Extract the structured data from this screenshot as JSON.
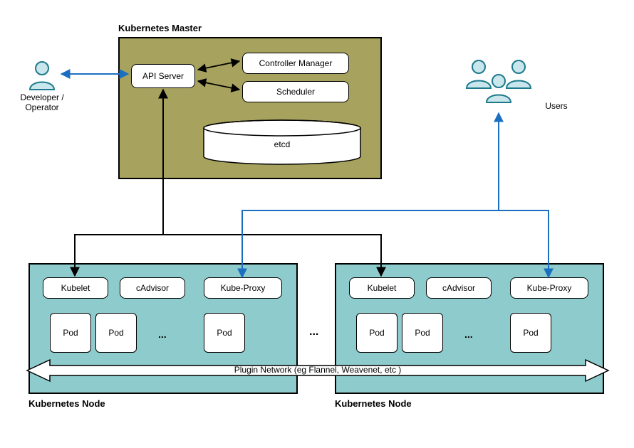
{
  "diagram": {
    "master": {
      "title": "Kubernetes Master",
      "api_server": "API Server",
      "controller_manager": "Controller Manager",
      "scheduler": "Scheduler",
      "etcd": "etcd"
    },
    "developer_label": "Developer / Operator",
    "users_label": "Users",
    "node_left": {
      "title": "Kubernetes Node",
      "kubelet": "Kubelet",
      "cadvisor": "cAdvisor",
      "kubeproxy": "Kube-Proxy",
      "pod": "Pod",
      "ellipsis": "..."
    },
    "node_right": {
      "title": "Kubernetes Node",
      "kubelet": "Kubelet",
      "cadvisor": "cAdvisor",
      "kubeproxy": "Kube-Proxy",
      "pod": "Pod",
      "ellipsis": "..."
    },
    "ellipsis_nodes": "...",
    "network_label": "Plugin Network (eg Flannel, Weavenet, etc )",
    "colors": {
      "master_bg": "#a7a25e",
      "node_bg": "#8ecbcc",
      "user_icon": "#1d7a8c",
      "blue_arrow": "#1b6fc1",
      "black_arrow": "#000000"
    }
  }
}
